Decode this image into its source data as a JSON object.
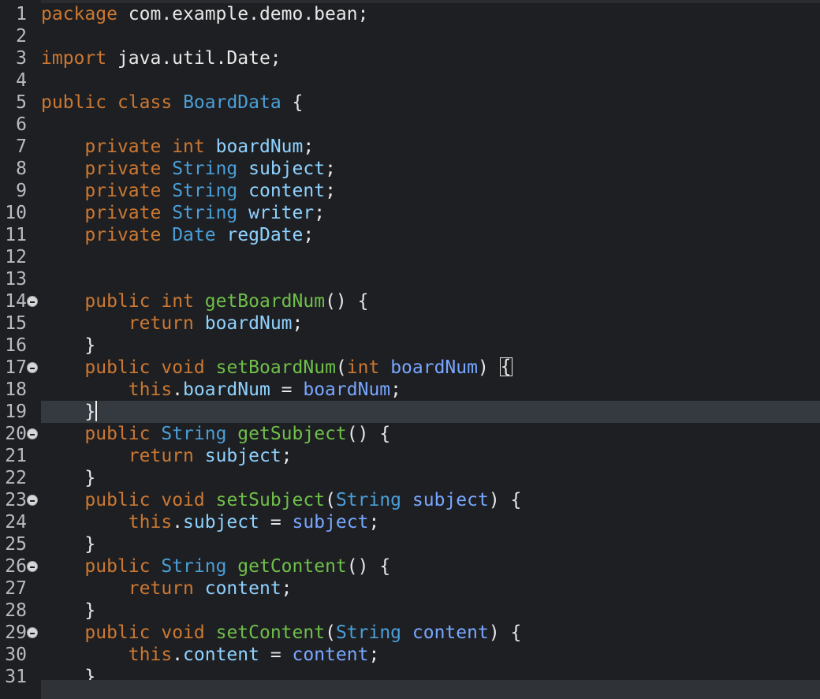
{
  "editor": {
    "line_numbers": [
      "1",
      "2",
      "3",
      "4",
      "5",
      "6",
      "7",
      "8",
      "9",
      "10",
      "11",
      "12",
      "13",
      "14",
      "15",
      "16",
      "17",
      "18",
      "19",
      "20",
      "21",
      "22",
      "23",
      "24",
      "25",
      "26",
      "27",
      "28",
      "29",
      "30",
      "31"
    ],
    "lines": [
      {
        "n": "1",
        "t": [
          {
            "c": "kw",
            "v": "package"
          },
          {
            "c": "punc",
            "v": " com.example.demo.bean;"
          }
        ]
      },
      {
        "n": "2",
        "t": []
      },
      {
        "n": "3",
        "t": [
          {
            "c": "kw",
            "v": "import"
          },
          {
            "c": "punc",
            "v": " java.util.Date;"
          }
        ]
      },
      {
        "n": "4",
        "t": []
      },
      {
        "n": "5",
        "t": [
          {
            "c": "kw",
            "v": "public"
          },
          {
            "c": "punc",
            "v": " "
          },
          {
            "c": "kw",
            "v": "class"
          },
          {
            "c": "punc",
            "v": " "
          },
          {
            "c": "type",
            "v": "BoardData"
          },
          {
            "c": "punc",
            "v": " {"
          }
        ]
      },
      {
        "n": "6",
        "t": []
      },
      {
        "n": "7",
        "t": [
          {
            "c": "punc",
            "v": "    "
          },
          {
            "c": "kw",
            "v": "private"
          },
          {
            "c": "punc",
            "v": " "
          },
          {
            "c": "kw",
            "v": "int"
          },
          {
            "c": "punc",
            "v": " "
          },
          {
            "c": "field",
            "v": "boardNum"
          },
          {
            "c": "punc",
            "v": ";"
          }
        ]
      },
      {
        "n": "8",
        "t": [
          {
            "c": "punc",
            "v": "    "
          },
          {
            "c": "kw",
            "v": "private"
          },
          {
            "c": "punc",
            "v": " "
          },
          {
            "c": "type",
            "v": "String"
          },
          {
            "c": "punc",
            "v": " "
          },
          {
            "c": "field",
            "v": "subject"
          },
          {
            "c": "punc",
            "v": ";"
          }
        ]
      },
      {
        "n": "9",
        "t": [
          {
            "c": "punc",
            "v": "    "
          },
          {
            "c": "kw",
            "v": "private"
          },
          {
            "c": "punc",
            "v": " "
          },
          {
            "c": "type",
            "v": "String"
          },
          {
            "c": "punc",
            "v": " "
          },
          {
            "c": "field",
            "v": "content"
          },
          {
            "c": "punc",
            "v": ";"
          }
        ]
      },
      {
        "n": "10",
        "t": [
          {
            "c": "punc",
            "v": "    "
          },
          {
            "c": "kw",
            "v": "private"
          },
          {
            "c": "punc",
            "v": " "
          },
          {
            "c": "type",
            "v": "String"
          },
          {
            "c": "punc",
            "v": " "
          },
          {
            "c": "field",
            "v": "writer"
          },
          {
            "c": "punc",
            "v": ";"
          }
        ]
      },
      {
        "n": "11",
        "t": [
          {
            "c": "punc",
            "v": "    "
          },
          {
            "c": "kw",
            "v": "private"
          },
          {
            "c": "punc",
            "v": " "
          },
          {
            "c": "type",
            "v": "Date"
          },
          {
            "c": "punc",
            "v": " "
          },
          {
            "c": "field",
            "v": "regDate"
          },
          {
            "c": "punc",
            "v": ";"
          }
        ]
      },
      {
        "n": "12",
        "t": []
      },
      {
        "n": "13",
        "t": []
      },
      {
        "n": "14",
        "fold": true,
        "t": [
          {
            "c": "punc",
            "v": "    "
          },
          {
            "c": "kw",
            "v": "public"
          },
          {
            "c": "punc",
            "v": " "
          },
          {
            "c": "kw",
            "v": "int"
          },
          {
            "c": "punc",
            "v": " "
          },
          {
            "c": "method",
            "v": "getBoardNum"
          },
          {
            "c": "punc",
            "v": "() {"
          }
        ]
      },
      {
        "n": "15",
        "t": [
          {
            "c": "punc",
            "v": "        "
          },
          {
            "c": "kw",
            "v": "return"
          },
          {
            "c": "punc",
            "v": " "
          },
          {
            "c": "field",
            "v": "boardNum"
          },
          {
            "c": "punc",
            "v": ";"
          }
        ]
      },
      {
        "n": "16",
        "t": [
          {
            "c": "punc",
            "v": "    }"
          }
        ]
      },
      {
        "n": "17",
        "fold": true,
        "t": [
          {
            "c": "punc",
            "v": "    "
          },
          {
            "c": "kw",
            "v": "public"
          },
          {
            "c": "punc",
            "v": " "
          },
          {
            "c": "kw",
            "v": "void"
          },
          {
            "c": "punc",
            "v": " "
          },
          {
            "c": "method",
            "v": "setBoardNum"
          },
          {
            "c": "punc",
            "v": "("
          },
          {
            "c": "kw",
            "v": "int"
          },
          {
            "c": "punc",
            "v": " "
          },
          {
            "c": "param",
            "v": "boardNum"
          },
          {
            "c": "punc",
            "v": ") "
          },
          {
            "c": "box",
            "v": "{"
          }
        ]
      },
      {
        "n": "18",
        "t": [
          {
            "c": "punc",
            "v": "        "
          },
          {
            "c": "kw",
            "v": "this"
          },
          {
            "c": "punc",
            "v": "."
          },
          {
            "c": "field",
            "v": "boardNum"
          },
          {
            "c": "punc",
            "v": " = "
          },
          {
            "c": "param",
            "v": "boardNum"
          },
          {
            "c": "punc",
            "v": ";"
          }
        ]
      },
      {
        "n": "19",
        "current": true,
        "t": [
          {
            "c": "punc",
            "v": "    }"
          },
          {
            "c": "caret",
            "v": ""
          }
        ]
      },
      {
        "n": "20",
        "fold": true,
        "t": [
          {
            "c": "punc",
            "v": "    "
          },
          {
            "c": "kw",
            "v": "public"
          },
          {
            "c": "punc",
            "v": " "
          },
          {
            "c": "type",
            "v": "String"
          },
          {
            "c": "punc",
            "v": " "
          },
          {
            "c": "method",
            "v": "getSubject"
          },
          {
            "c": "punc",
            "v": "() {"
          }
        ]
      },
      {
        "n": "21",
        "t": [
          {
            "c": "punc",
            "v": "        "
          },
          {
            "c": "kw",
            "v": "return"
          },
          {
            "c": "punc",
            "v": " "
          },
          {
            "c": "field",
            "v": "subject"
          },
          {
            "c": "punc",
            "v": ";"
          }
        ]
      },
      {
        "n": "22",
        "t": [
          {
            "c": "punc",
            "v": "    }"
          }
        ]
      },
      {
        "n": "23",
        "fold": true,
        "t": [
          {
            "c": "punc",
            "v": "    "
          },
          {
            "c": "kw",
            "v": "public"
          },
          {
            "c": "punc",
            "v": " "
          },
          {
            "c": "kw",
            "v": "void"
          },
          {
            "c": "punc",
            "v": " "
          },
          {
            "c": "method",
            "v": "setSubject"
          },
          {
            "c": "punc",
            "v": "("
          },
          {
            "c": "type",
            "v": "String"
          },
          {
            "c": "punc",
            "v": " "
          },
          {
            "c": "param",
            "v": "subject"
          },
          {
            "c": "punc",
            "v": ") {"
          }
        ]
      },
      {
        "n": "24",
        "t": [
          {
            "c": "punc",
            "v": "        "
          },
          {
            "c": "kw",
            "v": "this"
          },
          {
            "c": "punc",
            "v": "."
          },
          {
            "c": "field",
            "v": "subject"
          },
          {
            "c": "punc",
            "v": " = "
          },
          {
            "c": "param",
            "v": "subject"
          },
          {
            "c": "punc",
            "v": ";"
          }
        ]
      },
      {
        "n": "25",
        "t": [
          {
            "c": "punc",
            "v": "    }"
          }
        ]
      },
      {
        "n": "26",
        "fold": true,
        "t": [
          {
            "c": "punc",
            "v": "    "
          },
          {
            "c": "kw",
            "v": "public"
          },
          {
            "c": "punc",
            "v": " "
          },
          {
            "c": "type",
            "v": "String"
          },
          {
            "c": "punc",
            "v": " "
          },
          {
            "c": "method",
            "v": "getContent"
          },
          {
            "c": "punc",
            "v": "() {"
          }
        ]
      },
      {
        "n": "27",
        "t": [
          {
            "c": "punc",
            "v": "        "
          },
          {
            "c": "kw",
            "v": "return"
          },
          {
            "c": "punc",
            "v": " "
          },
          {
            "c": "field",
            "v": "content"
          },
          {
            "c": "punc",
            "v": ";"
          }
        ]
      },
      {
        "n": "28",
        "t": [
          {
            "c": "punc",
            "v": "    }"
          }
        ]
      },
      {
        "n": "29",
        "fold": true,
        "t": [
          {
            "c": "punc",
            "v": "    "
          },
          {
            "c": "kw",
            "v": "public"
          },
          {
            "c": "punc",
            "v": " "
          },
          {
            "c": "kw",
            "v": "void"
          },
          {
            "c": "punc",
            "v": " "
          },
          {
            "c": "method",
            "v": "setContent"
          },
          {
            "c": "punc",
            "v": "("
          },
          {
            "c": "type",
            "v": "String"
          },
          {
            "c": "punc",
            "v": " "
          },
          {
            "c": "param",
            "v": "content"
          },
          {
            "c": "punc",
            "v": ") {"
          }
        ]
      },
      {
        "n": "30",
        "t": [
          {
            "c": "punc",
            "v": "        "
          },
          {
            "c": "kw",
            "v": "this"
          },
          {
            "c": "punc",
            "v": "."
          },
          {
            "c": "field",
            "v": "content"
          },
          {
            "c": "punc",
            "v": " = "
          },
          {
            "c": "param",
            "v": "content"
          },
          {
            "c": "punc",
            "v": ";"
          }
        ]
      },
      {
        "n": "31",
        "t": [
          {
            "c": "punc",
            "v": "    }"
          }
        ]
      }
    ]
  },
  "colors": {
    "background": "#1e1f22",
    "keyword": "#cc7832",
    "type": "#4a9fd8",
    "field": "#8fd2ff",
    "method": "#6fbf4a",
    "parameter": "#78a6ff",
    "current_line": "#343a40"
  }
}
